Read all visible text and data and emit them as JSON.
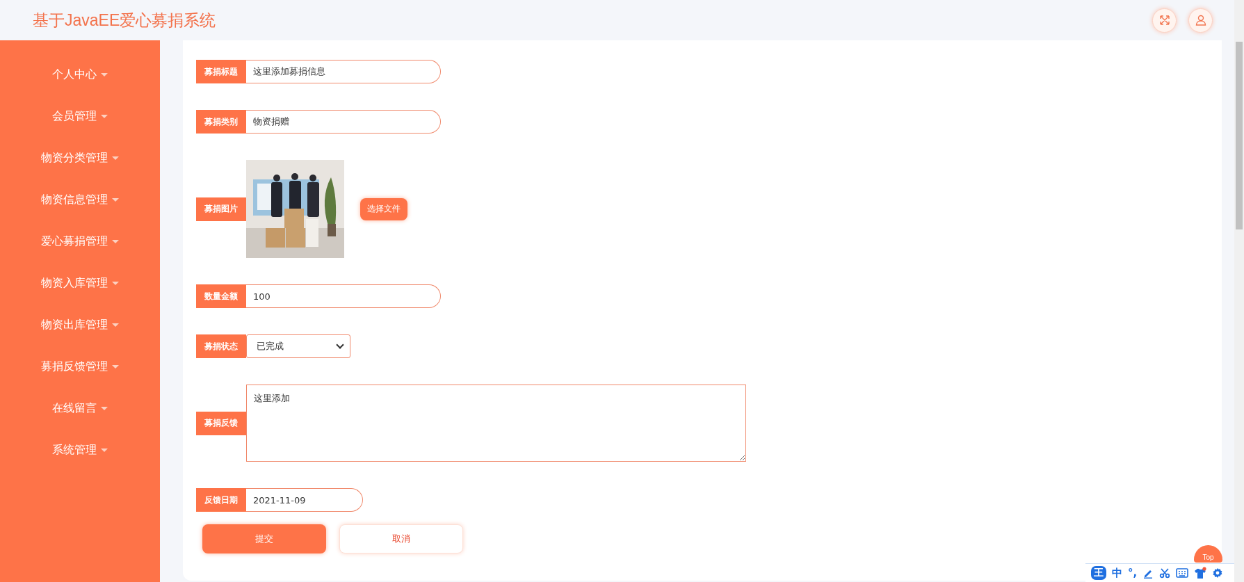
{
  "header": {
    "title": "基于JavaEE爱心募捐系统"
  },
  "sidebar": {
    "items": [
      {
        "label": "个人中心"
      },
      {
        "label": "会员管理"
      },
      {
        "label": "物资分类管理"
      },
      {
        "label": "物资信息管理"
      },
      {
        "label": "爱心募捐管理"
      },
      {
        "label": "物资入库管理"
      },
      {
        "label": "物资出库管理"
      },
      {
        "label": "募捐反馈管理"
      },
      {
        "label": "在线留言"
      },
      {
        "label": "系统管理"
      }
    ]
  },
  "form": {
    "fields": [
      {
        "kind": "text",
        "label": "募捐标题",
        "value": "这里添加募捐信息"
      },
      {
        "kind": "text",
        "label": "募捐类别",
        "value": "物资捐赠"
      },
      {
        "label": "募捐图片",
        "button": "选择文件"
      },
      {
        "kind": "text",
        "label": "数量金额",
        "value": "100"
      },
      {
        "kind": "select",
        "label": "募捐状态",
        "value": "已完成"
      },
      {
        "kind": "textarea",
        "label": "募捐反馈",
        "value": "这里添加"
      },
      {
        "kind": "date",
        "label": "反馈日期",
        "value": "2021-11-09"
      }
    ],
    "buttons": [
      {
        "kind": "primary",
        "label": "提交"
      },
      {
        "kind": "secondary",
        "label": "取消"
      }
    ]
  },
  "back_to_top": {
    "label": "Top"
  },
  "ime_toolbar": {
    "logo": "王",
    "mode": "中",
    "punctuation": "°,"
  }
}
